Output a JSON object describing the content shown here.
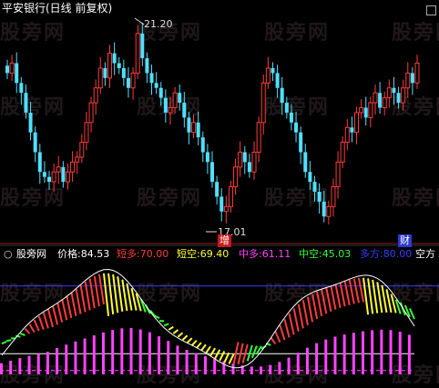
{
  "colors": {
    "background": "#000000",
    "up": "#ff3b3b",
    "down": "#4fe0ff",
    "yellow": "#ffff33",
    "green": "#33ff33",
    "magenta": "#ff44ff",
    "blue": "#3b3bff",
    "white": "#ffffff",
    "axis": "#8b1a1a",
    "watermark": "#3a2a2e"
  },
  "top_panel": {
    "title": "平安银行(日线 前复权)",
    "high_marker": "21.20",
    "low_marker": "17.01",
    "buy_badge": "增",
    "finance_badge": "财",
    "menu_icon": "square-menu-icon"
  },
  "indicator_panel": {
    "name": "股旁网",
    "stats": [
      {
        "label": "价格:",
        "value": "84.53"
      },
      {
        "label": "短多:",
        "value": "70.00"
      },
      {
        "label": "短空:",
        "value": "69.40"
      },
      {
        "label": "中多:",
        "value": "61.11"
      },
      {
        "label": "中空:",
        "value": "45.03"
      },
      {
        "label": "多方:",
        "value": "80.00"
      },
      {
        "label": "空方",
        "value": ""
      }
    ]
  },
  "watermark_text": "股旁网"
}
